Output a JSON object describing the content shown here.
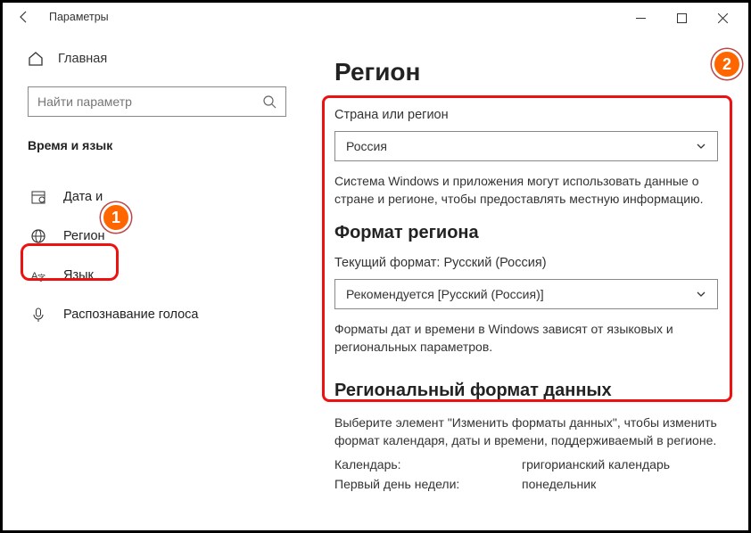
{
  "window": {
    "title": "Параметры"
  },
  "sidebar": {
    "home": "Главная",
    "search_placeholder": "Найти параметр",
    "section": "Время и язык",
    "items": [
      {
        "label": "Дата и"
      },
      {
        "label": "Регион"
      },
      {
        "label": "Язык"
      },
      {
        "label": "Распознавание голоса"
      }
    ]
  },
  "content": {
    "heading": "Регион",
    "country_label": "Страна или регион",
    "country_value": "Россия",
    "country_desc": "Система Windows и приложения могут использовать данные о стране и регионе, чтобы предоставлять местную информацию.",
    "format_heading": "Формат региона",
    "current_format": "Текущий формат: Русский (Россия)",
    "format_value": "Рекомендуется [Русский (Россия)]",
    "format_desc": "Форматы дат и времени в Windows зависят от языковых и региональных параметров.",
    "regional_heading": "Региональный формат данных",
    "regional_desc": "Выберите элемент \"Изменить форматы данных\", чтобы изменить формат календаря, даты и времени, поддерживаемый в регионе.",
    "kv": {
      "calendar_k": "Календарь:",
      "calendar_v": "григорианский календарь",
      "firstday_k": "Первый день недели:",
      "firstday_v": "понедельник"
    }
  },
  "badges": {
    "one": "1",
    "two": "2"
  }
}
